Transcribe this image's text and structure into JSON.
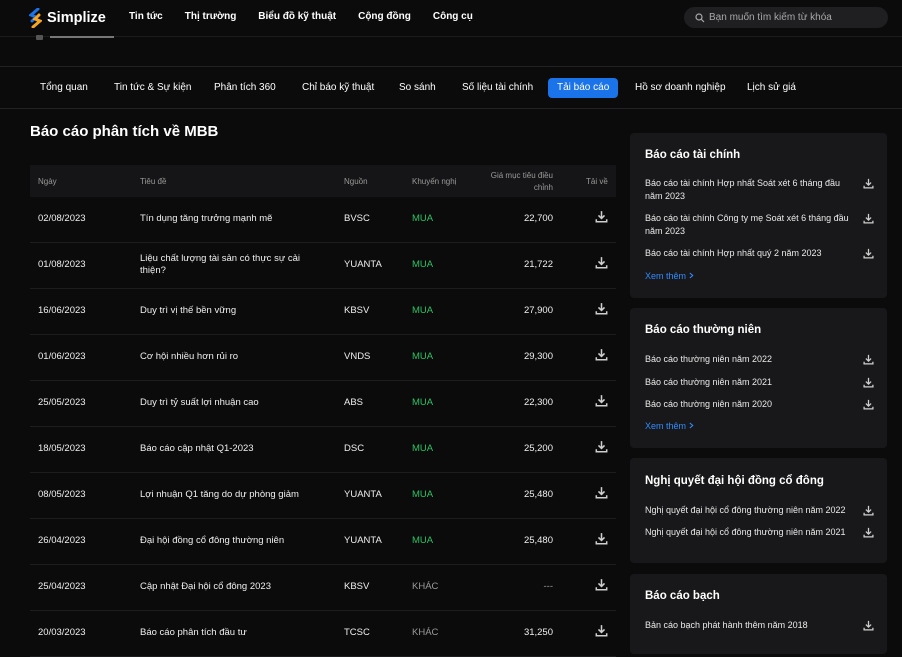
{
  "brand": {
    "name": "Simplize"
  },
  "nav": [
    "Tin tức",
    "Thị trường",
    "Biểu đồ kỹ thuật",
    "Cộng đồng",
    "Công cụ"
  ],
  "search": {
    "placeholder": "Bạn muốn tìm kiếm từ khóa"
  },
  "tabs": [
    {
      "label": "Tổng quan",
      "active": false
    },
    {
      "label": "Tin tức & Sự kiện",
      "active": false
    },
    {
      "label": "Phân tích 360",
      "active": false
    },
    {
      "label": "Chỉ báo kỹ thuật",
      "active": false
    },
    {
      "label": "So sánh",
      "active": false
    },
    {
      "label": "Số liệu tài chính",
      "active": false
    },
    {
      "label": "Tải báo cáo",
      "active": true
    },
    {
      "label": "Hồ sơ doanh nghiệp",
      "active": false
    },
    {
      "label": "Lịch sử giá",
      "active": false
    }
  ],
  "page_title": "Báo cáo phân tích về MBB",
  "table": {
    "headers": {
      "date": "Ngày",
      "title": "Tiêu đề",
      "source": "Nguồn",
      "rec": "Khuyến nghị",
      "target_line1": "Giá mục tiêu điều",
      "target_line2": "chỉnh",
      "download": "Tải về"
    },
    "rows": [
      {
        "date": "02/08/2023",
        "title": "Tín dụng tăng trưởng mạnh mẽ",
        "source": "BVSC",
        "rec": "MUA",
        "price": "22,700"
      },
      {
        "date": "01/08/2023",
        "title": "Liệu chất lượng tài sản có thực sự cải thiện?",
        "source": "YUANTA",
        "rec": "MUA",
        "price": "21,722"
      },
      {
        "date": "16/06/2023",
        "title": "Duy trì vị thế bền vững",
        "source": "KBSV",
        "rec": "MUA",
        "price": "27,900"
      },
      {
        "date": "01/06/2023",
        "title": "Cơ hội nhiều hơn rủi ro",
        "source": "VNDS",
        "rec": "MUA",
        "price": "29,300"
      },
      {
        "date": "25/05/2023",
        "title": "Duy trì tỷ suất lợi nhuận cao",
        "source": "ABS",
        "rec": "MUA",
        "price": "22,300"
      },
      {
        "date": "18/05/2023",
        "title": "Báo cáo cập nhật Q1-2023",
        "source": "DSC",
        "rec": "MUA",
        "price": "25,200"
      },
      {
        "date": "08/05/2023",
        "title": "Lợi nhuận Q1 tăng do dự phòng giảm",
        "source": "YUANTA",
        "rec": "MUA",
        "price": "25,480"
      },
      {
        "date": "26/04/2023",
        "title": "Đại hội đồng cổ đông thường niên",
        "source": "YUANTA",
        "rec": "MUA",
        "price": "25,480"
      },
      {
        "date": "25/04/2023",
        "title": "Cập nhật Đại hội cổ đông 2023",
        "source": "KBSV",
        "rec": "KHÁC",
        "price": "---"
      },
      {
        "date": "20/03/2023",
        "title": "Báo cáo phân tích đầu tư",
        "source": "TCSC",
        "rec": "KHÁC",
        "price": "31,250"
      }
    ]
  },
  "panels": [
    {
      "title": "Báo cáo tài chính",
      "items": [
        "Báo cáo tài chính Hợp nhất Soát xét 6 tháng đầu năm 2023",
        "Báo cáo tài chính Công ty mẹ Soát xét 6 tháng đầu năm 2023",
        "Báo cáo tài chính Hợp nhất quý 2 năm 2023"
      ],
      "more": "Xem thêm"
    },
    {
      "title": "Báo cáo thường niên",
      "items": [
        "Báo cáo thường niên năm 2022",
        "Báo cáo thường niên năm 2021",
        "Báo cáo thường niên năm 2020"
      ],
      "more": "Xem thêm"
    },
    {
      "title": "Nghị quyết đại hội đồng cổ đông",
      "items": [
        "Nghị quyết đại hội cổ đông thường niên năm 2022",
        "Nghị quyết đại hội cổ đông thường niên năm 2021"
      ]
    },
    {
      "title": "Báo cáo bạch",
      "items": [
        "Bản cáo bạch phát hành thêm năm 2018"
      ]
    }
  ],
  "colors": {
    "accent": "#1a73e8",
    "buy": "#2ec263",
    "link": "#2f8cff"
  }
}
